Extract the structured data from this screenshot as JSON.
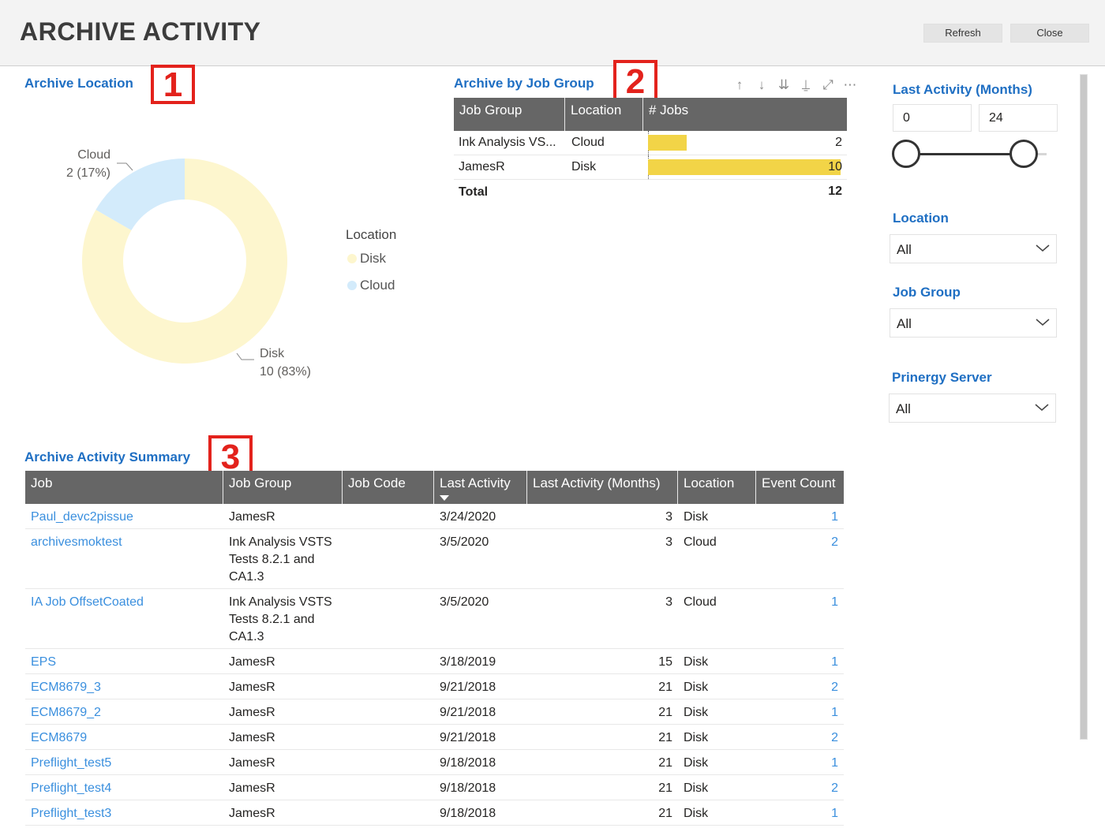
{
  "header": {
    "title": "ARCHIVE ACTIVITY",
    "refresh_label": "Refresh",
    "close_label": "Close"
  },
  "badges": [
    "1",
    "2",
    "3"
  ],
  "archive_location": {
    "title": "Archive Location",
    "legend_title": "Location",
    "legend": [
      {
        "name": "Disk",
        "color": "#fdf6ce"
      },
      {
        "name": "Cloud",
        "color": "#d3ebfb"
      }
    ],
    "labels": [
      {
        "name": "Cloud",
        "value": "2 (17%)"
      },
      {
        "name": "Disk",
        "value": "10 (83%)"
      }
    ]
  },
  "chart_data": {
    "type": "pie",
    "title": "Archive Location",
    "categories": [
      "Disk",
      "Cloud"
    ],
    "values": [
      10,
      2
    ],
    "colors": [
      "#fdf6ce",
      "#d3ebfb"
    ],
    "legend_placement": "right"
  },
  "archive_by_job_group": {
    "title": "Archive by Job Group",
    "columns": [
      "Job Group",
      "Location",
      "# Jobs"
    ],
    "rows": [
      {
        "group": "Ink Analysis VS...",
        "location": "Cloud",
        "jobs": "2",
        "jobs_value": 2
      },
      {
        "group": "JamesR",
        "location": "Disk",
        "jobs": "10",
        "jobs_value": 10
      }
    ],
    "bar_max": 10,
    "total_label": "Total",
    "total_value": "12"
  },
  "filters": {
    "last_activity": {
      "label": "Last Activity (Months)",
      "min": "0",
      "max": "24"
    },
    "location": {
      "label": "Location",
      "value": "All"
    },
    "job_group": {
      "label": "Job Group",
      "value": "All"
    },
    "server": {
      "label": "Prinergy Server",
      "value": "All"
    }
  },
  "summary": {
    "title": "Archive Activity Summary",
    "columns": [
      "Job",
      "Job Group",
      "Job Code",
      "Last Activity",
      "Last Activity (Months)",
      "Location",
      "Event Count"
    ],
    "rows": [
      {
        "job": "Paul_devc2pissue",
        "group": [
          "JamesR"
        ],
        "code": "",
        "date": "3/24/2020",
        "months": "3",
        "location": "Disk",
        "count": "1"
      },
      {
        "job": "archivesmoktest",
        "group": [
          "Ink Analysis VSTS",
          "Tests 8.2.1 and",
          "CA1.3"
        ],
        "code": "",
        "date": "3/5/2020",
        "months": "3",
        "location": "Cloud",
        "count": "2"
      },
      {
        "job": "IA Job OffsetCoated",
        "group": [
          "Ink Analysis VSTS",
          "Tests 8.2.1 and",
          "CA1.3"
        ],
        "code": "",
        "date": "3/5/2020",
        "months": "3",
        "location": "Cloud",
        "count": "1"
      },
      {
        "job": "EPS",
        "group": [
          "JamesR"
        ],
        "code": "",
        "date": "3/18/2019",
        "months": "15",
        "location": "Disk",
        "count": "1"
      },
      {
        "job": "ECM8679_3",
        "group": [
          "JamesR"
        ],
        "code": "",
        "date": "9/21/2018",
        "months": "21",
        "location": "Disk",
        "count": "2"
      },
      {
        "job": "ECM8679_2",
        "group": [
          "JamesR"
        ],
        "code": "",
        "date": "9/21/2018",
        "months": "21",
        "location": "Disk",
        "count": "1"
      },
      {
        "job": "ECM8679",
        "group": [
          "JamesR"
        ],
        "code": "",
        "date": "9/21/2018",
        "months": "21",
        "location": "Disk",
        "count": "2"
      },
      {
        "job": "Preflight_test5",
        "group": [
          "JamesR"
        ],
        "code": "",
        "date": "9/18/2018",
        "months": "21",
        "location": "Disk",
        "count": "1"
      },
      {
        "job": "Preflight_test4",
        "group": [
          "JamesR"
        ],
        "code": "",
        "date": "9/18/2018",
        "months": "21",
        "location": "Disk",
        "count": "2"
      },
      {
        "job": "Preflight_test3",
        "group": [
          "JamesR"
        ],
        "code": "",
        "date": "9/18/2018",
        "months": "21",
        "location": "Disk",
        "count": "1"
      }
    ]
  }
}
